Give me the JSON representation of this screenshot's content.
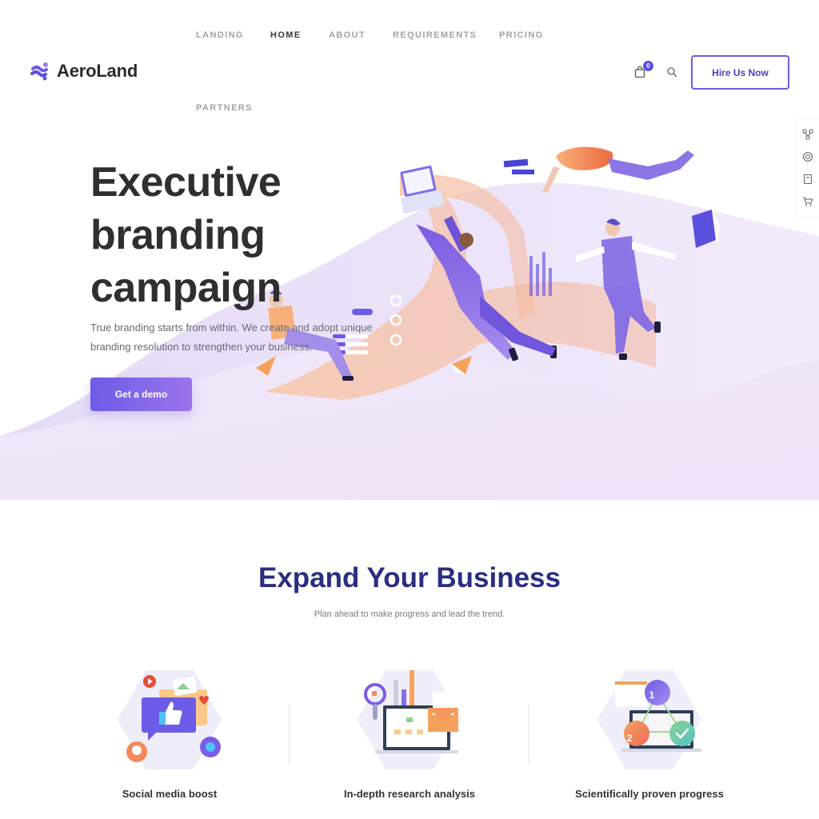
{
  "brand": {
    "name": "AeroLand",
    "accent": "#6c5ce7",
    "title_color": "#2b2d82"
  },
  "nav": {
    "items": [
      {
        "label": "LANDING",
        "active": false
      },
      {
        "label": "HOME",
        "active": true
      },
      {
        "label": "ABOUT",
        "active": false
      },
      {
        "label": "REQUIREMENTS",
        "active": false
      },
      {
        "label": "PRICING",
        "active": false
      },
      {
        "label": "PARTNERS",
        "active": false
      }
    ]
  },
  "header": {
    "cart_icon": "shopping-bag-icon",
    "cart_count": "0",
    "search_icon": "search-icon",
    "cta_label": "Hire Us Now"
  },
  "side_toolbar": {
    "icons": [
      "share-nodes-icon",
      "lifebuoy-icon",
      "book-icon",
      "cart-icon"
    ]
  },
  "hero": {
    "title_lines": [
      "Executive",
      "branding",
      "campaign"
    ],
    "subtitle": "True branding starts from within. We create and adopt unique branding resolution to strengthen your business.",
    "cta_label": "Get a demo",
    "illustration": "team-floating-illustration"
  },
  "features_section": {
    "title": "Expand Your Business",
    "subtitle": "Plan ahead to make progress and lead the trend.",
    "items": [
      {
        "label": "Social media boost",
        "icon": "social-media-icon"
      },
      {
        "label": "In-depth research analysis",
        "icon": "research-analysis-icon"
      },
      {
        "label": "Scientifically proven progress",
        "icon": "progress-steps-icon",
        "step_labels": [
          "1",
          "2"
        ]
      }
    ]
  }
}
